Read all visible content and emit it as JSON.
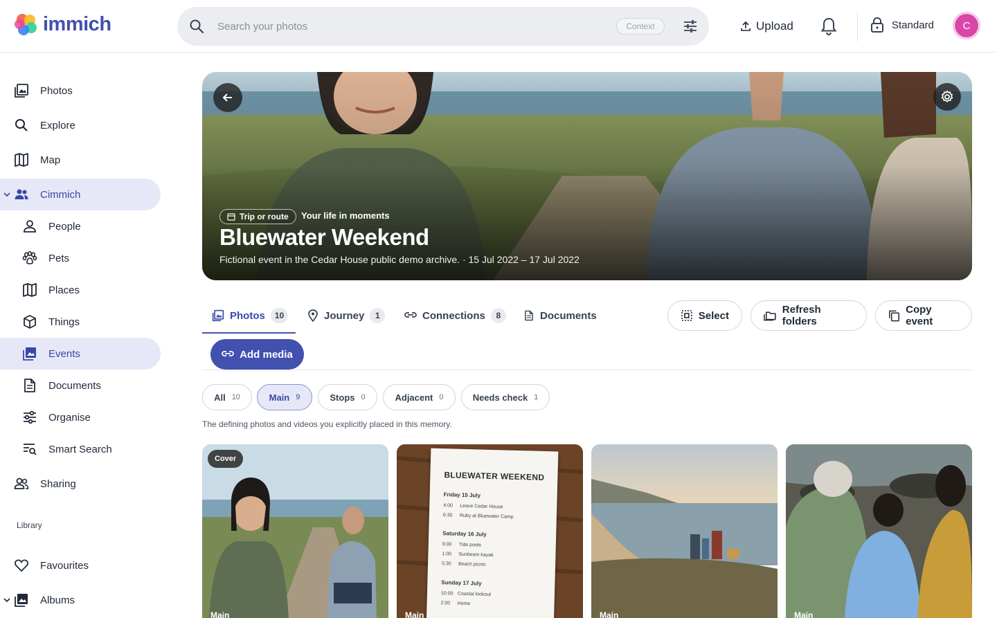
{
  "app": {
    "name": "immich"
  },
  "header": {
    "search_placeholder": "Search your photos",
    "context_chip": "Context",
    "upload_label": "Upload",
    "mode_label": "Standard",
    "avatar_initial": "C"
  },
  "sidebar": {
    "items": [
      {
        "label": "Photos",
        "icon": "photos-icon"
      },
      {
        "label": "Explore",
        "icon": "search-icon"
      },
      {
        "label": "Map",
        "icon": "map-icon"
      },
      {
        "label": "Cimmich",
        "icon": "people-group-icon"
      },
      {
        "label": "People",
        "icon": "person-icon"
      },
      {
        "label": "Pets",
        "icon": "paw-icon"
      },
      {
        "label": "Places",
        "icon": "map-icon"
      },
      {
        "label": "Things",
        "icon": "cube-icon"
      },
      {
        "label": "Events",
        "icon": "image-multiple-icon"
      },
      {
        "label": "Documents",
        "icon": "document-icon"
      },
      {
        "label": "Organise",
        "icon": "tune-icon"
      },
      {
        "label": "Smart Search",
        "icon": "text-search-icon"
      },
      {
        "label": "Sharing",
        "icon": "share-people-icon"
      }
    ],
    "library_label": "Library",
    "library_items": [
      {
        "label": "Favourites",
        "icon": "heart-icon"
      },
      {
        "label": "Albums",
        "icon": "album-icon"
      }
    ],
    "active_item": "Events"
  },
  "hero": {
    "chip": "Trip or route",
    "tagline": "Your life in moments",
    "title": "Bluewater Weekend",
    "subtitle": "Fictional event in the Cedar House public demo archive. · 15 Jul 2022 – 17 Jul 2022"
  },
  "tabs": [
    {
      "label": "Photos",
      "count": "10"
    },
    {
      "label": "Journey",
      "count": "1"
    },
    {
      "label": "Connections",
      "count": "8"
    },
    {
      "label": "Documents",
      "count": ""
    }
  ],
  "actions": {
    "select": "Select",
    "refresh": "Refresh folders",
    "copy": "Copy event",
    "add_media": "Add media"
  },
  "filters": [
    {
      "label": "All",
      "count": "10"
    },
    {
      "label": "Main",
      "count": "9"
    },
    {
      "label": "Stops",
      "count": "0"
    },
    {
      "label": "Adjacent",
      "count": "0"
    },
    {
      "label": "Needs check",
      "count": "1"
    }
  ],
  "filter_description": "The defining photos and videos you explicitly placed in this memory.",
  "photos": [
    {
      "badge": "Cover",
      "label": "Main"
    },
    {
      "label": "Main"
    },
    {
      "label": "Main"
    },
    {
      "label": "Main"
    }
  ],
  "note": {
    "title": "BLUEWATER WEEKEND",
    "days": [
      {
        "day": "Friday 15 July",
        "lines": [
          [
            "4:00",
            "Leave Cedar House"
          ],
          [
            "6:30",
            "Ruby at Bluewater Camp"
          ]
        ]
      },
      {
        "day": "Saturday 16 July",
        "lines": [
          [
            "9:00",
            "Tide pools"
          ],
          [
            "1:00",
            "Sunbeam kayak"
          ],
          [
            "5:30",
            "Beach picnic"
          ]
        ]
      },
      {
        "day": "Sunday 17 July",
        "lines": [
          [
            "10:00",
            "Coastal lookout"
          ],
          [
            "2:00",
            "Home"
          ]
        ]
      }
    ]
  },
  "colors": {
    "accent": "#4250af",
    "active_bg": "#e6e8f7",
    "avatar": "#d946a8"
  }
}
